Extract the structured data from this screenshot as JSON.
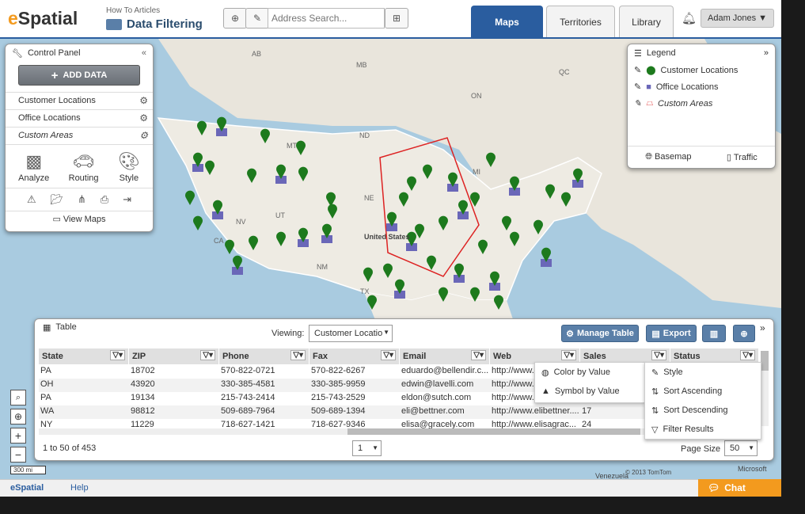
{
  "header": {
    "logo_e": "e",
    "logo_rest": "Spatial",
    "articles": "How To Articles",
    "title": "Data Filtering",
    "search_placeholder": "Address Search...",
    "tabs": [
      "Maps",
      "Territories",
      "Library"
    ],
    "user": "Adam Jones"
  },
  "map": {
    "labels": [
      {
        "t": "AB"
      },
      {
        "t": "MB"
      },
      {
        "t": "QC"
      },
      {
        "t": "ON"
      },
      {
        "t": "ND"
      },
      {
        "t": "MT"
      },
      {
        "t": "NE"
      },
      {
        "t": "NV"
      },
      {
        "t": "UT"
      },
      {
        "t": "CA"
      },
      {
        "t": "NM"
      },
      {
        "t": "TX"
      },
      {
        "t": "MI"
      },
      {
        "t": "United States"
      },
      {
        "t": "Venezuela"
      }
    ],
    "scale": "300 mi",
    "copyright": "© 2013 TomTom",
    "brand": "Microsoft"
  },
  "control_panel": {
    "title": "Control Panel",
    "add_data": "ADD DATA",
    "layers": [
      "Customer Locations",
      "Office Locations",
      "Custom Areas"
    ],
    "tools": [
      "Analyze",
      "Routing",
      "Style"
    ],
    "view_maps": "View Maps"
  },
  "legend": {
    "title": "Legend",
    "items": [
      "Customer Locations",
      "Office Locations",
      "Custom Areas"
    ],
    "basemap": "Basemap",
    "traffic": "Traffic"
  },
  "table": {
    "title": "Table",
    "viewing_label": "Viewing:",
    "viewing_value": "Customer Locatio",
    "manage": "Manage Table",
    "export": "Export",
    "columns": [
      "State",
      "ZIP",
      "Phone",
      "Fax",
      "Email",
      "Web",
      "Sales",
      "Status"
    ],
    "rows": [
      [
        "PA",
        "18702",
        "570-822-0721",
        "570-822-6267",
        "eduardo@bellendir.c...",
        "http://www.e",
        "",
        ""
      ],
      [
        "OH",
        "43920",
        "330-385-4581",
        "330-385-9959",
        "edwin@lavelli.com",
        "http://www.e",
        "",
        ""
      ],
      [
        "PA",
        "19134",
        "215-743-2414",
        "215-743-2529",
        "eldon@sutch.com",
        "http://www.e",
        "",
        ""
      ],
      [
        "WA",
        "98812",
        "509-689-7964",
        "509-689-1394",
        "eli@bettner.com",
        "http://www.elibettner....",
        "17",
        ""
      ],
      [
        "NY",
        "11229",
        "718-627-1421",
        "718-627-9346",
        "elisa@gracely.com",
        "http://www.elisagrac...",
        "24",
        ""
      ]
    ],
    "paging": "1 to 50 of 453",
    "page": "1",
    "page_size_label": "Page Size",
    "page_size": "50",
    "menu_left": [
      "Color by Value",
      "Symbol by Value"
    ],
    "menu_right": [
      "Style",
      "Sort Ascending",
      "Sort Descending",
      "Filter Results"
    ]
  },
  "footer": {
    "brand": "eSpatial",
    "help": "Help",
    "chat": "Chat"
  }
}
